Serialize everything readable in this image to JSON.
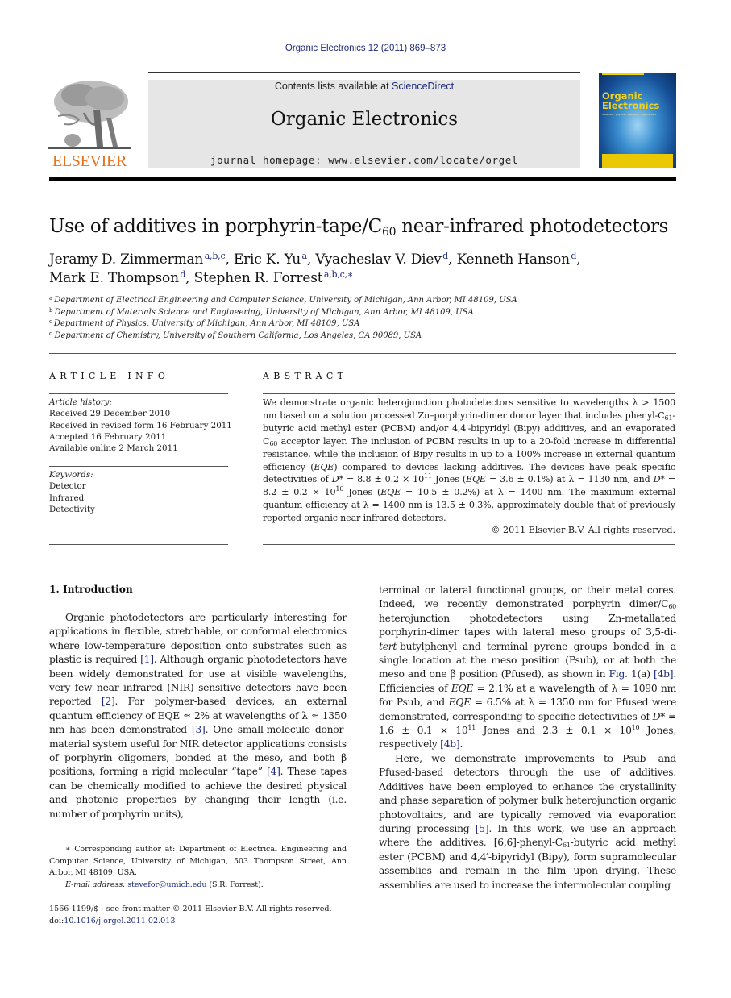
{
  "running_head": "Organic Electronics 12 (2011) 869–873",
  "masthead": {
    "publisher_logo_text": "ELSEVIER",
    "contents_prefix": "Contents lists available at ",
    "contents_link": "ScienceDirect",
    "journal_name": "Organic Electronics",
    "homepage": "journal homepage: www.elsevier.com/locate/orgel",
    "cover": {
      "title_line1": "Organic",
      "title_line2": "Electronics",
      "subtitle": "materials · physics · chemistry · applications"
    },
    "colors": {
      "elsevier_orange": "#e9711c",
      "link_blue": "#1f2a7a",
      "masthead_gray": "#e6e6e6",
      "cover_yellow": "#f3d21b"
    }
  },
  "article": {
    "title_main": "Use of additives in porphyrin-tape/C",
    "title_sub": "60",
    "title_end": " near-infrared photodetectors",
    "authors": [
      {
        "name": "Jeramy D. Zimmerman",
        "affil": "a,b,c"
      },
      {
        "name": "Eric K. Yu",
        "affil": "a"
      },
      {
        "name": "Vyacheslav V. Diev",
        "affil": "d"
      },
      {
        "name": "Kenneth Hanson",
        "affil": "d"
      },
      {
        "name": "Mark E. Thompson",
        "affil": "d"
      },
      {
        "name": "Stephen R. Forrest",
        "affil": "a,b,c,∗"
      }
    ],
    "affiliations": [
      {
        "key": "a",
        "text": "Department of Electrical Engineering and Computer Science, University of Michigan, Ann Arbor, MI 48109, USA"
      },
      {
        "key": "b",
        "text": "Department of Materials Science and Engineering, University of Michigan, Ann Arbor, MI 48109, USA"
      },
      {
        "key": "c",
        "text": "Department of Physics, University of Michigan, Ann Arbor, MI 48109, USA"
      },
      {
        "key": "d",
        "text": "Department of Chemistry, University of Southern California, Los Angeles, CA 90089, USA"
      }
    ]
  },
  "article_info": {
    "heading": "ARTICLE INFO",
    "history_label": "Article history:",
    "history": [
      "Received 29 December 2010",
      "Received in revised form 16 February 2011",
      "Accepted 16 February 2011",
      "Available online 2 March 2011"
    ],
    "keywords_label": "Keywords:",
    "keywords": [
      "Detector",
      "Infrared",
      "Detectivity"
    ]
  },
  "abstract": {
    "heading": "ABSTRACT",
    "s1": "We demonstrate organic heterojunction photodetectors sensitive to wavelengths λ > 1500 nm based on a solution processed Zn–porphyrin-dimer donor layer that includes phenyl-C",
    "s1_sub": "61",
    "s2": "-butyric acid methyl ester (PCBM) and/or 4,4′-bipyridyl (Bipy) additives, and an evaporated C",
    "s2_sub": "60",
    "s3": " acceptor layer. The inclusion of PCBM results in up to a 20-fold increase in differential resistance, while the inclusion of Bipy results in up to a 100% increase in external quantum efficiency (",
    "eqe": "EQE",
    "s4": ") compared to devices lacking additives. The devices have peak specific detectivities of ",
    "dstar": "D*",
    "s5": " = 8.8 ± 0.2 × 10",
    "s5_sup": "11",
    "s6": " Jones (",
    "s7": " = 3.6 ± 0.1%) at λ = 1130 nm, and ",
    "s8": " = 8.2 ± 0.2 × 10",
    "s8_sup": "10",
    "s9": " Jones (",
    "s10": " = 10.5 ± 0.2%) at λ = 1400 nm. The maximum external quantum efficiency at λ = 1400 nm is 13.5 ± 0.3%, approximately double that of previously reported organic near infrared detectors.",
    "copyright": "© 2011 Elsevier B.V. All rights reserved."
  },
  "introduction": {
    "heading": "1. Introduction",
    "p1": {
      "a": "Organic photodetectors are particularly interesting for applications in flexible, stretchable, or conformal electronics where low-temperature deposition onto substrates such as plastic is required ",
      "ref1": "[1]",
      "b": ". Although organic photodetectors have been widely demonstrated for use at visible wavelengths, very few near infrared (NIR) sensitive detectors have been reported ",
      "ref2": "[2]",
      "c": ". For polymer-based devices, an external quantum efficiency of EQE ≈ 2% at wavelengths of λ ≈ 1350 nm has been demonstrated ",
      "ref3": "[3]",
      "d": ". One small-molecule donor-material system useful for NIR detector applications consists of porphyrin oligomers, bonded at the meso, and both β positions, forming a rigid molecular “tape” ",
      "ref4": "[4]",
      "e": ". These tapes can be chemically modified to achieve the desired physical and photonic properties by changing their length (i.e. number of porphyrin units), terminal or lateral functional groups, or their metal cores. Indeed, we recently demonstrated porphyrin dimer/C",
      "e_sub": "60",
      "f": " heterojunction photodetectors using Zn-metallated porphyrin-dimer tapes with lateral meso groups of 3,5-di-",
      "tert": "tert",
      "g": "-butylphenyl and terminal pyrene groups bonded in a single location at the meso position (Psub), or at both the meso and one β position (Pfused), as shown in ",
      "fig": "Fig. 1",
      "h": "(a) ",
      "ref4b": "[4b]",
      "i": ". Efficiencies of ",
      "eqe": "EQE",
      "j": " = 2.1% at a wavelength of λ = 1090 nm for Psub, and ",
      "k": " = 6.5% at λ = 1350 nm for Pfused were demonstrated, corresponding to specific detectivities of ",
      "dstar": "D*",
      "l": " = 1.6 ± 0.1 × 10",
      "l_sup": "11",
      "m": " Jones and 2.3 ± 0.1 × 10",
      "m_sup": "10",
      "n": " Jones, respectively ",
      "o": "."
    },
    "p2": {
      "a": "Here, we demonstrate improvements to Psub- and Pfused-based detectors through the use of additives. Additives have been employed to enhance the crystallinity and phase separation of polymer bulk heterojunction organic photovoltaics, and are typically removed via evaporation during processing ",
      "ref5": "[5]",
      "b": ". In this work, we use an approach where the additives, [6,6]-phenyl-C",
      "b_sub": "61",
      "c": "-butyric acid methyl ester (PCBM) and 4,4′-bipyridyl (Bipy), form supramolecular assemblies and remain in the film upon drying. These assemblies are used to increase the intermolecular coupling"
    }
  },
  "footnote": {
    "corresponding": "∗ Corresponding author at: Department of Electrical Engineering and Computer Science, University of Michigan, 503 Thompson Street, Ann Arbor, MI 48109, USA.",
    "email_label": "E-mail address: ",
    "email": "stevefor@umich.edu",
    "email_owner": " (S.R. Forrest)."
  },
  "footer": {
    "issn": "1566-1199/$ - see front matter © 2011 Elsevier B.V. All rights reserved.",
    "doi_label": "doi:",
    "doi": "10.1016/j.orgel.2011.02.013"
  }
}
